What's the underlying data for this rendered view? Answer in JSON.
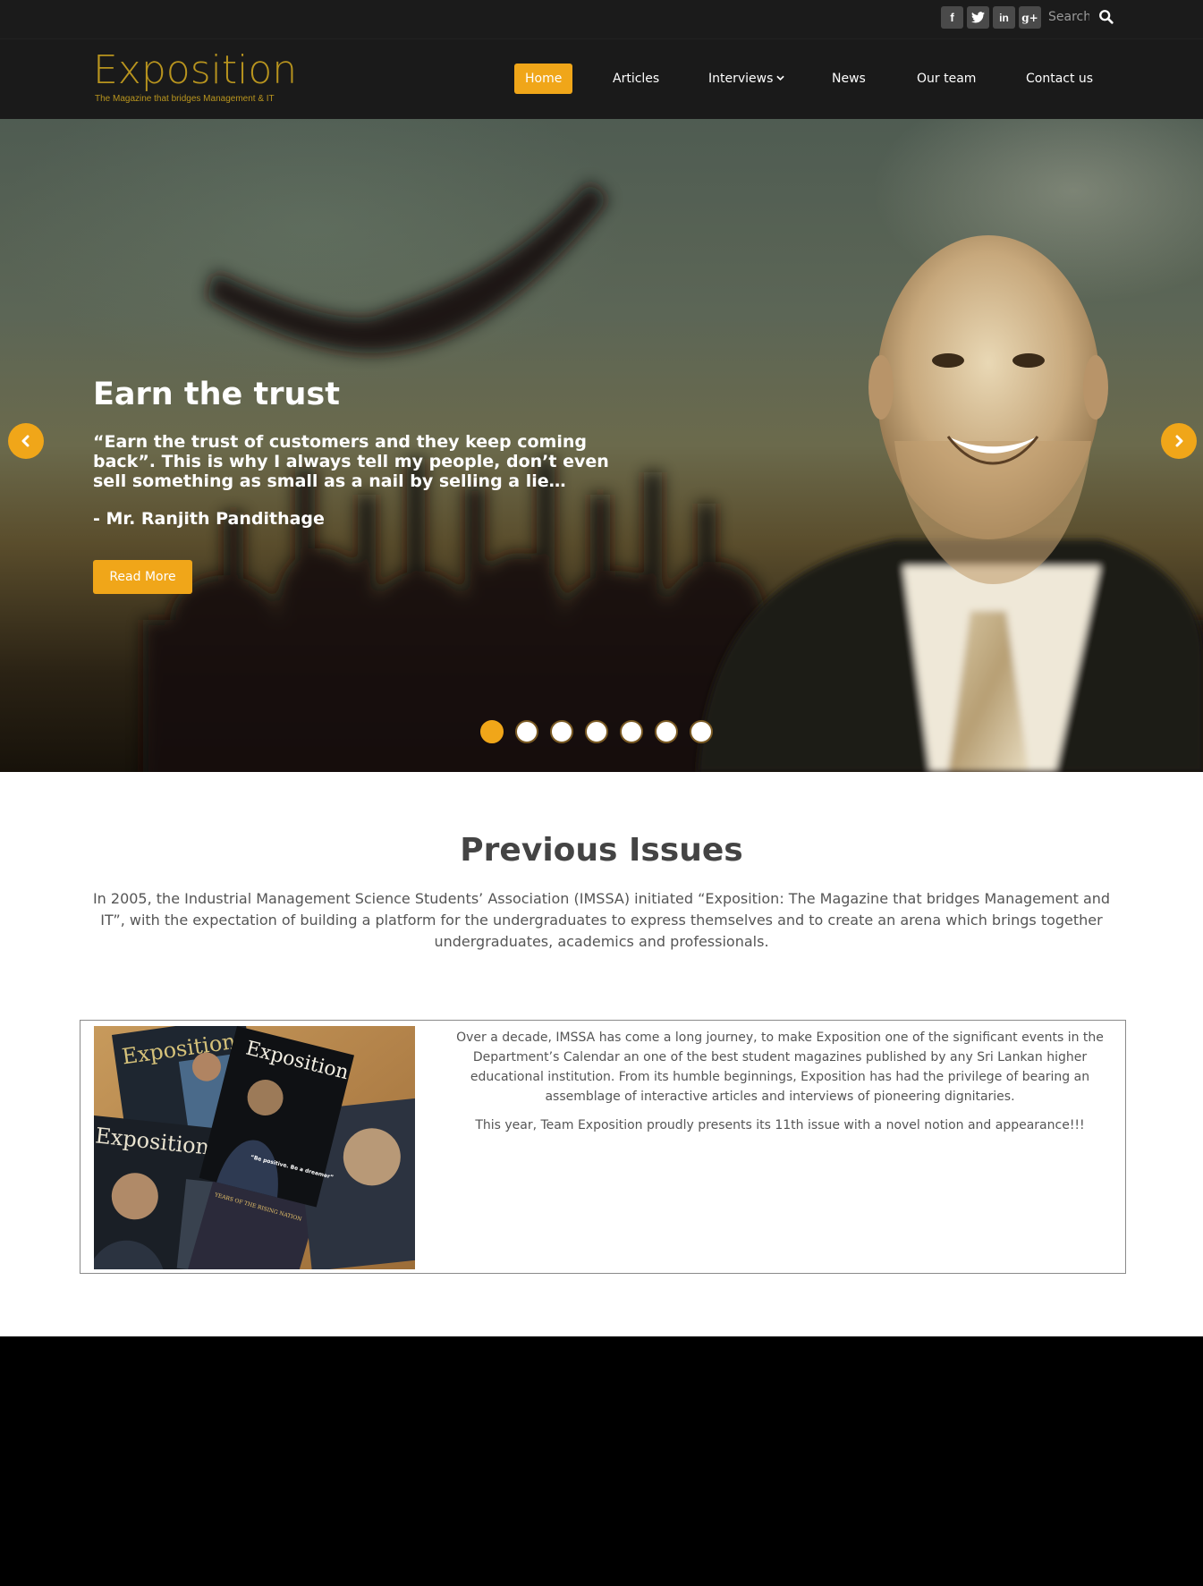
{
  "topbar": {
    "social": [
      {
        "name": "facebook",
        "glyph": "f"
      },
      {
        "name": "twitter",
        "glyph": "t"
      },
      {
        "name": "linkedin",
        "glyph": "in"
      },
      {
        "name": "google-plus",
        "glyph": "g+"
      }
    ],
    "search_placeholder": "Search",
    "search_icon": "search-icon"
  },
  "brand": {
    "title": "Exposition",
    "tagline": "The Magazine that bridges Management & IT",
    "color": "#b8941e"
  },
  "nav": {
    "items": [
      {
        "label": "Home",
        "active": true
      },
      {
        "label": "Articles"
      },
      {
        "label": "Interviews",
        "has_dropdown": true
      },
      {
        "label": "News"
      },
      {
        "label": "Our team"
      },
      {
        "label": "Contact us"
      }
    ],
    "accent": "#f0a619"
  },
  "hero": {
    "title": "Earn the trust",
    "quote": "“Earn the trust of customers and they keep coming back”. This is why I always tell my people, don’t even sell something as small as a nail by selling a lie…",
    "author": "- Mr. Ranjith Pandithage",
    "button_label": "Read More",
    "slide_count": 7,
    "active_slide": 1
  },
  "previous_issues": {
    "title": "Previous Issues",
    "description": "In 2005, the Industrial Management Science Students’ Association (IMSSA) initiated “Exposition: The Magazine that bridges Management and IT”, with the expectation of building a platform for the undergraduates to express themselves and to create an arena which brings together undergraduates, academics and professionals.",
    "card": {
      "paragraph1": "Over a decade, IMSSA has come a long journey, to make Exposition one of the significant events in the Department’s Calendar an one of the best student magazines published by any Sri Lankan higher educational institution. From its humble beginnings, Exposition has had the privilege of bearing an assemblage of interactive articles and interviews of pioneering dignitaries.",
      "paragraph2": "This year, Team Exposition proudly presents its 11th issue with a novel notion and appearance!!!",
      "covers": [
        {
          "title": "Exposition"
        },
        {
          "title": "Exposition",
          "quote": "“Be positive. Be a dreamer”"
        },
        {
          "title": "Exposition"
        },
        {
          "title": "YEARS OF THE RISING NATION"
        }
      ]
    }
  }
}
